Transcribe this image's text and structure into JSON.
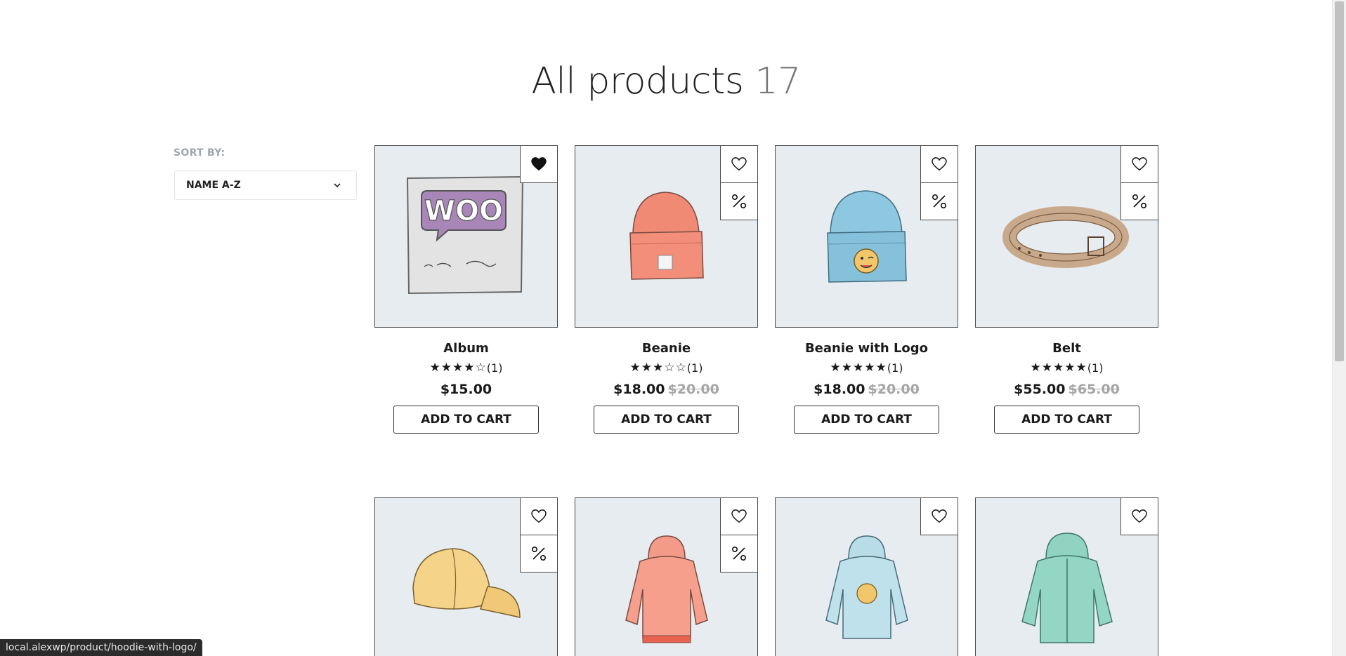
{
  "page": {
    "title": "All products",
    "count": "17"
  },
  "sort": {
    "label": "SORT BY:",
    "selected": "NAME A-Z"
  },
  "products": [
    {
      "name": "Album",
      "rating": 4,
      "reviews": "(1)",
      "price": "$15.00",
      "old_price": "",
      "wishlisted": true,
      "on_sale": false,
      "image": "album-icon",
      "button": "ADD TO CART"
    },
    {
      "name": "Beanie",
      "rating": 3,
      "reviews": "(1)",
      "price": "$18.00",
      "old_price": "$20.00",
      "wishlisted": false,
      "on_sale": true,
      "image": "beanie-icon",
      "button": "ADD TO CART"
    },
    {
      "name": "Beanie with Logo",
      "rating": 5,
      "reviews": "(1)",
      "price": "$18.00",
      "old_price": "$20.00",
      "wishlisted": false,
      "on_sale": true,
      "image": "beanie-logo-icon",
      "button": "ADD TO CART"
    },
    {
      "name": "Belt",
      "rating": 5,
      "reviews": "(1)",
      "price": "$55.00",
      "old_price": "$65.00",
      "wishlisted": false,
      "on_sale": true,
      "image": "belt-icon",
      "button": "ADD TO CART"
    },
    {
      "wishlisted": false,
      "on_sale": true,
      "image": "cap-icon"
    },
    {
      "wishlisted": false,
      "on_sale": true,
      "image": "hoodie-icon"
    },
    {
      "wishlisted": false,
      "on_sale": false,
      "image": "hoodie-logo-icon"
    },
    {
      "wishlisted": false,
      "on_sale": false,
      "image": "hoodie-zipper-icon"
    }
  ],
  "status_bar": {
    "url": "local.alexwp/product/hoodie-with-logo/"
  },
  "colors": {
    "card_bg": "#e7ecf1",
    "border": "#4a4a4a",
    "muted": "#a0a6ad"
  }
}
